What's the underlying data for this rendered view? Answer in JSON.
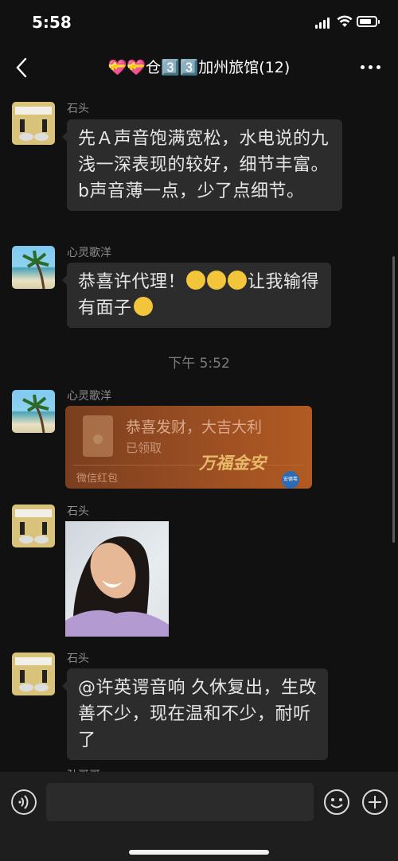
{
  "status": {
    "time": "5:58"
  },
  "header": {
    "title": "💝💝仓3️⃣3️⃣加州旅馆(12)"
  },
  "messages": [
    {
      "sender": "石头",
      "text": "先Ａ声音饱满宽松，水电说的九浅一深表现的较好，细节丰富。b声音薄一点，少了点细节。"
    },
    {
      "sender": "心灵歌洋",
      "text_before": "恭喜许代理！",
      "text_after": "让我输得有面子"
    },
    {
      "timestamp": "下午 5:52"
    },
    {
      "sender": "心灵歌洋",
      "packet": {
        "title": "恭喜发财，大吉大利",
        "status": "已领取",
        "footer": "微信红包",
        "brand": "万福金安",
        "badge": "安德希"
      }
    },
    {
      "sender": "石头",
      "image": "photo"
    },
    {
      "sender": "石头",
      "text": "@许英谔音响 久休复出，生改善不少，现在温和不少，耐听了"
    },
    {
      "sender": "孙哥哥"
    }
  ],
  "colors": {
    "background": "#111111",
    "bubble": "#2c2c2c",
    "packet": "#9a4e22"
  }
}
